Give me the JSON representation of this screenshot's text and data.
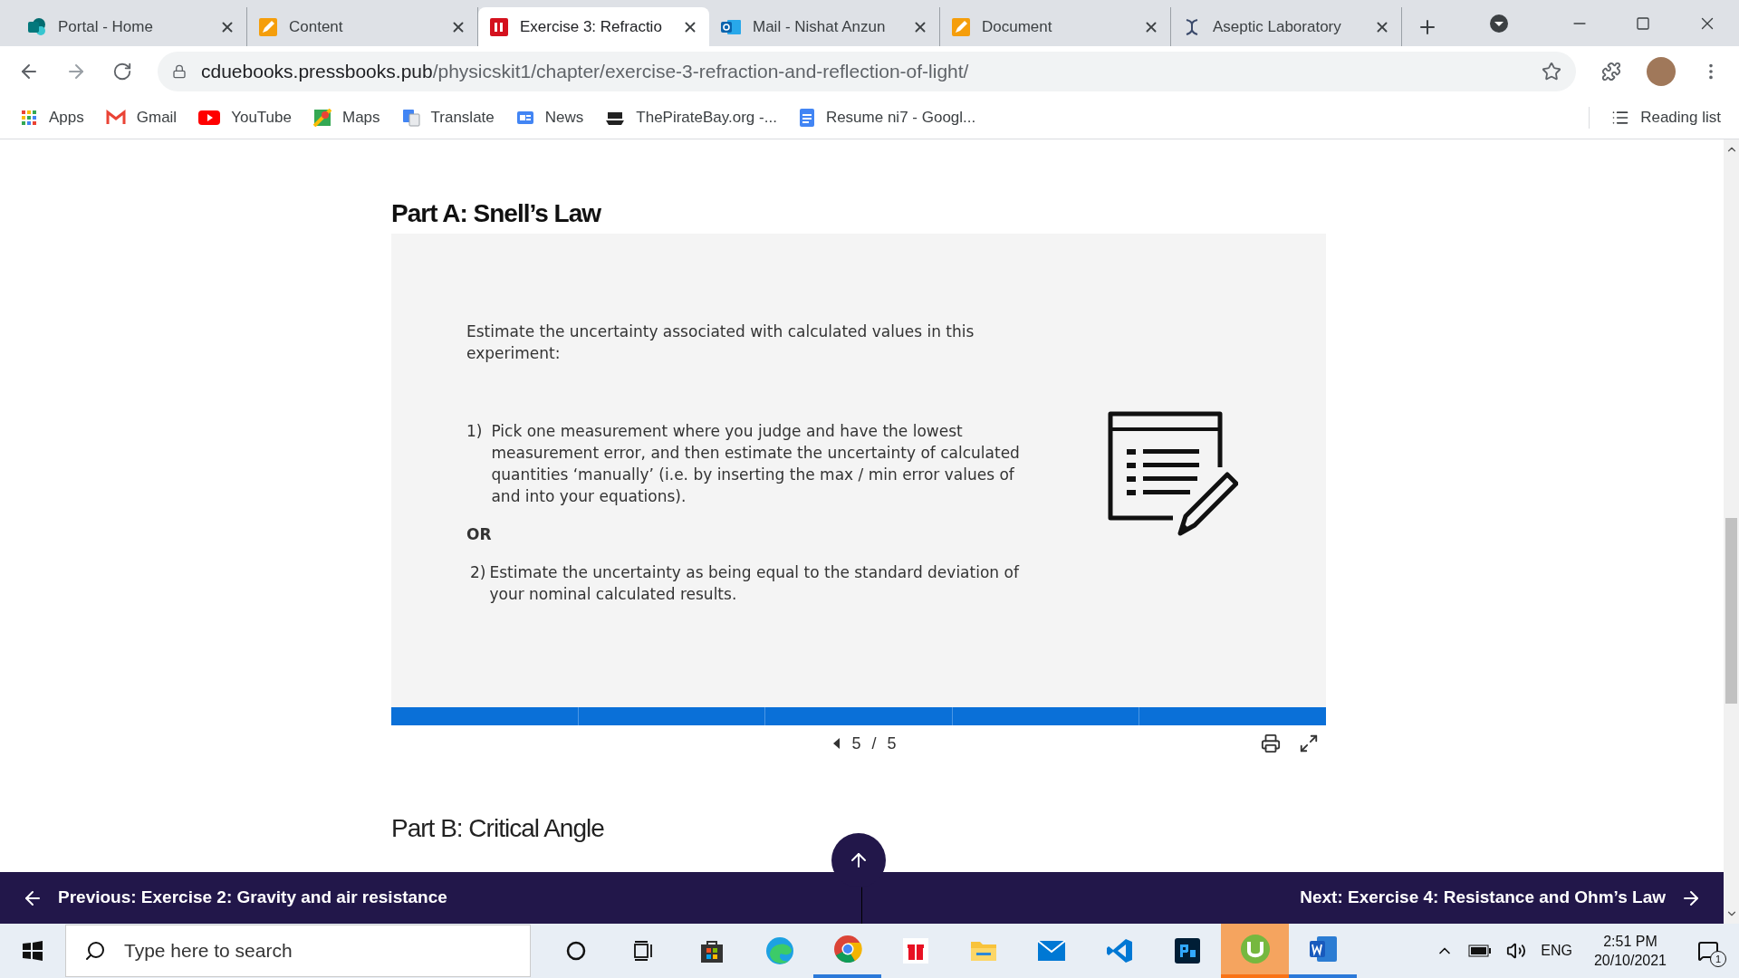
{
  "tabs": [
    {
      "title": "Portal - Home",
      "selected": false
    },
    {
      "title": "Content",
      "selected": false
    },
    {
      "title": "Exercise 3: Refractio",
      "selected": true
    },
    {
      "title": "Mail - Nishat Anzun",
      "selected": false
    },
    {
      "title": "Document",
      "selected": false
    },
    {
      "title": "Aseptic Laboratory",
      "selected": false
    }
  ],
  "address": {
    "host": "cduebooks.pressbooks.pub",
    "path": "/physicskit1/chapter/exercise-3-refraction-and-reflection-of-light/"
  },
  "bookmarks": [
    "Apps",
    "Gmail",
    "YouTube",
    "Maps",
    "Translate",
    "News",
    "ThePirateBay.org -...",
    "Resume ni7 - Googl..."
  ],
  "reading_list": "Reading list",
  "page": {
    "part_a": "Part A: Snell’s Law",
    "slide": {
      "intro": "Estimate the uncertainty associated with calculated values in this experiment:",
      "item_1_number": "1)",
      "item_1": "Pick one measurement where you judge and  have the lowest measurement error, and then estimate the uncertainty of calculated quantities ‘manually’ (i.e. by inserting the max / min error values of and  into your equations).",
      "or": "OR",
      "item_2_number": "2)",
      "item_2": "Estimate the uncertainty as being equal to the standard deviation of your nominal calculated results.",
      "progress": [
        {
          "selected": true
        },
        {
          "selected": true
        },
        {
          "selected": true
        },
        {
          "selected": true
        },
        {
          "selected": true
        }
      ],
      "current": "5",
      "separator": "/",
      "total": "5"
    },
    "part_b": "Part B: Critical Angle"
  },
  "nav": {
    "previous": "Previous: Exercise 2: Gravity and air resistance",
    "next": "Next: Exercise 4: Resistance and Ohm’s Law"
  },
  "taskbar": {
    "search_placeholder": "Type here to search",
    "apps": [
      {
        "active": false
      },
      {
        "active": false
      },
      {
        "active": false
      },
      {
        "active": false
      },
      {
        "active": true
      },
      {
        "active": false
      },
      {
        "active": false
      },
      {
        "active": false
      },
      {
        "active": false
      },
      {
        "active": false
      },
      {
        "active": true
      },
      {
        "active": true
      }
    ],
    "language": "ENG",
    "time": "2:51 PM",
    "date": "20/10/2021",
    "notifications": "1"
  }
}
